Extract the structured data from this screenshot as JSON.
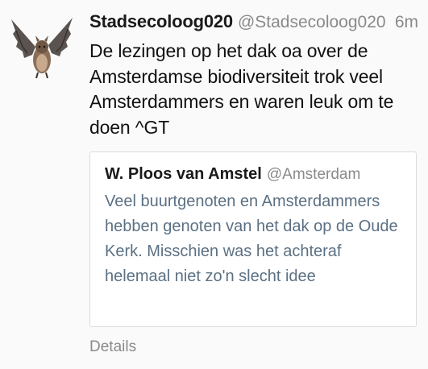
{
  "tweet": {
    "avatar_icon": "bat-icon",
    "display_name": "Stadsecoloog020",
    "handle": "@Stadsecoloog020",
    "time": "6m",
    "text": "De lezingen op het dak oa over de Amsterdamse biodiversiteit trok veel Amsterdammers en waren leuk om te doen ^GT"
  },
  "quoted": {
    "display_name": "W. Ploos van Amstel",
    "handle": "@Amsterdam",
    "text": "Veel buurtgenoten en Amsterdammers hebben genoten van het dak op de Oude Kerk. Misschien was het achteraf helemaal niet zo'n slecht idee"
  },
  "footer": {
    "details_label": "Details"
  }
}
